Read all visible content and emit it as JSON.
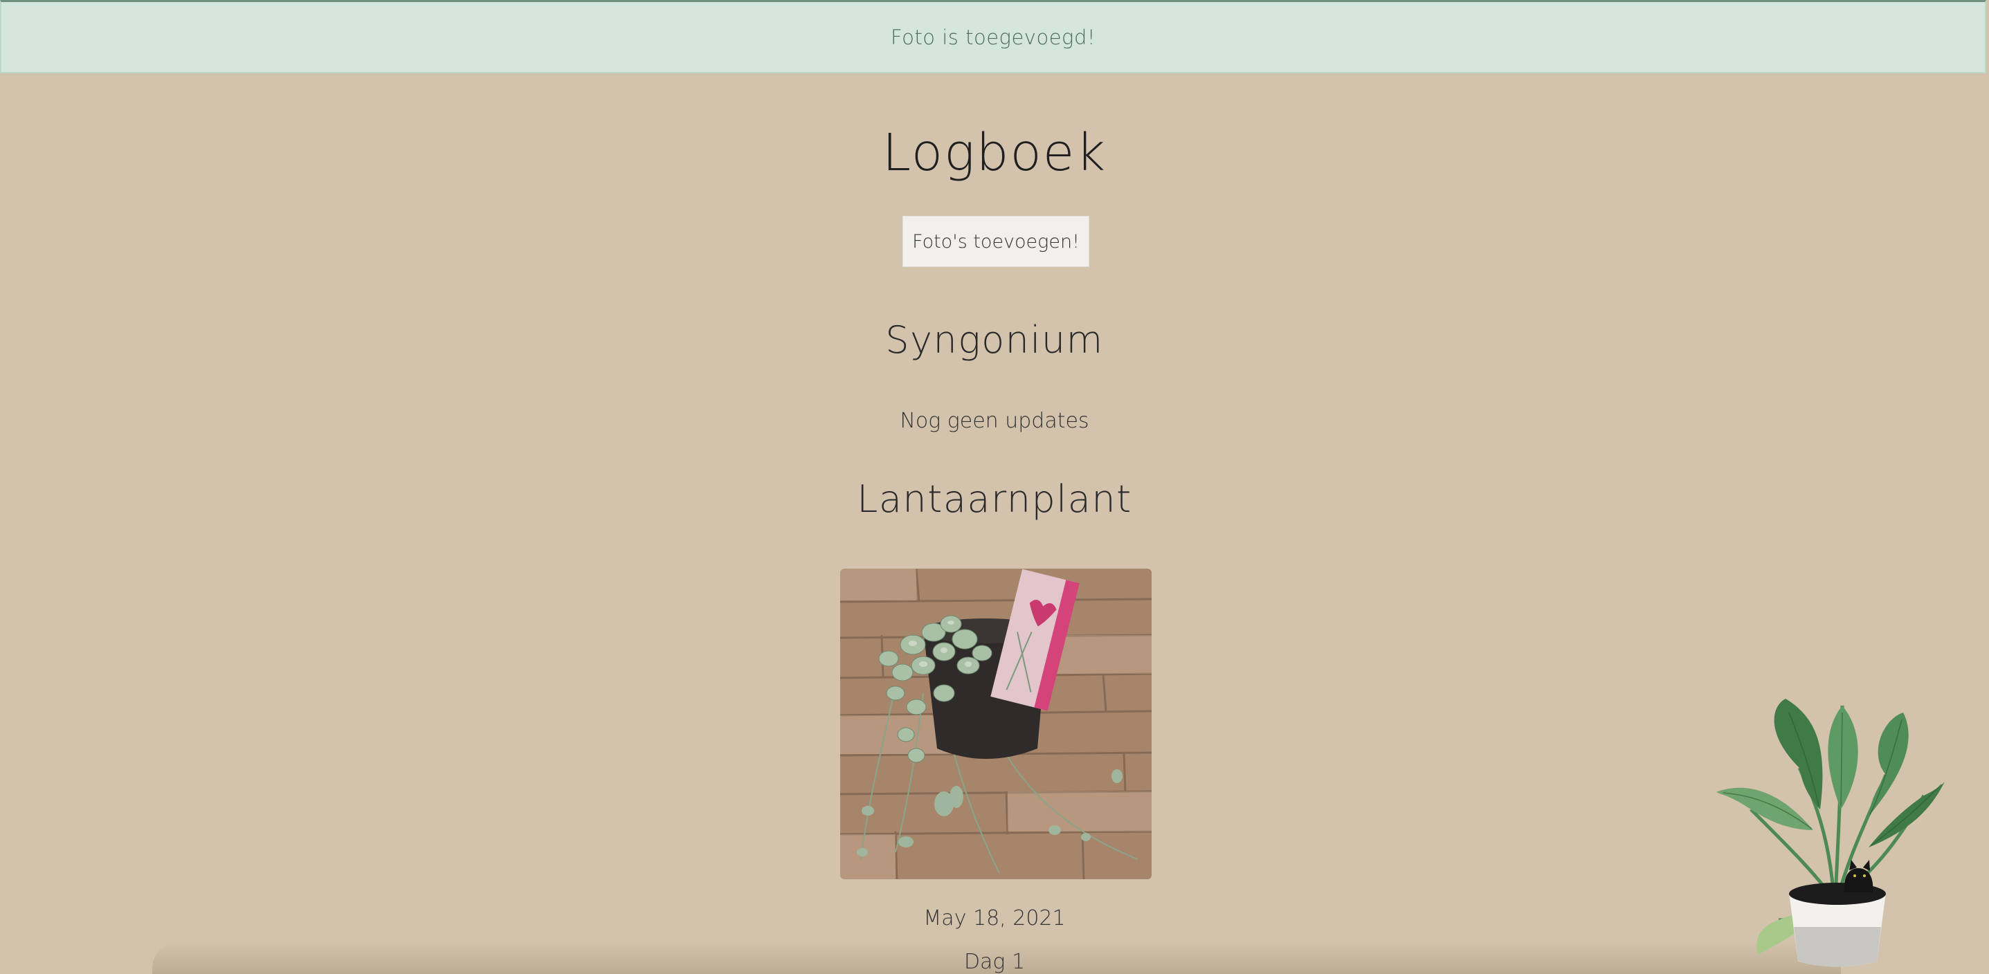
{
  "alert": {
    "message": "Foto is toegevoegd!",
    "colors": {
      "background": "#d4e6dd",
      "text": "#4d6b5f"
    }
  },
  "header": {
    "title": "Logboek",
    "add_photos_label": "Foto's toevoegen!"
  },
  "plants": [
    {
      "name": "Syngonium",
      "status_text": "Nog geen updates"
    },
    {
      "name": "Lantaarnplant",
      "entries": [
        {
          "date": "May 18, 2021",
          "day_label": "Dag 1"
        }
      ]
    }
  ],
  "theme": {
    "background": "#d3c3ad",
    "button_background": "#f1f0ef"
  },
  "icons": {
    "corner_decoration": "potted-plant-with-cat-icon"
  }
}
